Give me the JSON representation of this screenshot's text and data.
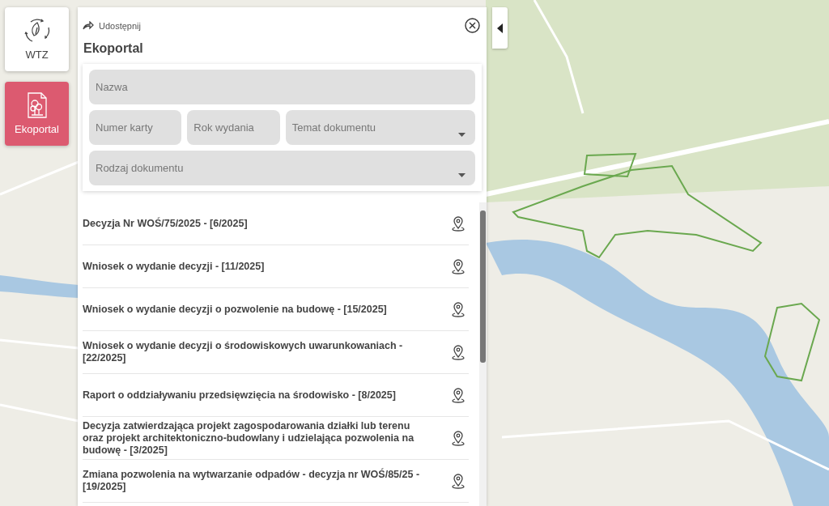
{
  "nav": [
    {
      "label": "WTZ",
      "kind": "recycle",
      "selected": false
    },
    {
      "label": "Ekoportal",
      "kind": "document",
      "selected": true
    }
  ],
  "panel": {
    "share": "Udostępnij",
    "title": "Ekoportal"
  },
  "filter_rows": [
    [
      {
        "placeholder": "Nazwa",
        "kind": "text"
      }
    ],
    [
      {
        "placeholder": "Numer karty",
        "kind": "text"
      },
      {
        "placeholder": "Rok wydania",
        "kind": "text"
      },
      {
        "placeholder": "Temat dokumentu",
        "kind": "select"
      }
    ],
    [
      {
        "placeholder": "Rodzaj dokumentu",
        "kind": "select"
      }
    ]
  ],
  "documents": [
    {
      "title": "Decyzja Nr WOŚ/75/2025 - [6/2025]"
    },
    {
      "title": "Wniosek o wydanie decyzji - [11/2025]"
    },
    {
      "title": "Wniosek o wydanie decyzji o pozwolenie na budowę - [15/2025]"
    },
    {
      "title": "Wniosek o wydanie decyzji o środowiskowych uwarunkowaniach - [22/2025]"
    },
    {
      "title": "Raport o oddziaływaniu przedsięwzięcia na środowisko - [8/2025]"
    },
    {
      "title": "Decyzja zatwierdzająca projekt zagospodarowania działki lub terenu oraz projekt architektoniczno-budowlany i udzielająca pozwolenia na budowę - [3/2025]"
    },
    {
      "title": "Zmiana pozwolenia na wytwarzanie odpadów - decyzja nr WOŚ/85/25 - [19/2025]"
    }
  ]
}
